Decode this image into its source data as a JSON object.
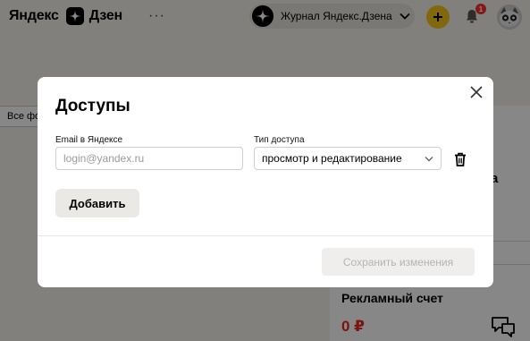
{
  "header": {
    "logo_yandex": "Яндекс",
    "logo_dzen": "Дзен",
    "more_label": "···",
    "channel_name": "Журнал Яндекс.Дзена",
    "notifications_count": "1"
  },
  "background": {
    "filter_label": "Все фо",
    "card_fragment": "а",
    "ad_account_title": "Рекламный счет",
    "ad_account_amount": "0 ₽"
  },
  "modal": {
    "title": "Доступы",
    "email_label": "Email в Яндексе",
    "email_placeholder": "login@yandex.ru",
    "email_value": "",
    "access_label": "Тип доступа",
    "access_value": "просмотр и редактирование",
    "add_label": "Добавить",
    "save_label": "Сохранить изменения"
  },
  "colors": {
    "accent_yellow": "#f5c518",
    "badge_red": "#ff2e2e",
    "amount_red": "#e8271d"
  },
  "icons": [
    "dzen-logo-icon",
    "channel-avatar-icon",
    "chevron-down-icon",
    "plus-icon",
    "bell-icon",
    "avatar-icon",
    "close-icon",
    "trash-icon",
    "chat-icon"
  ]
}
